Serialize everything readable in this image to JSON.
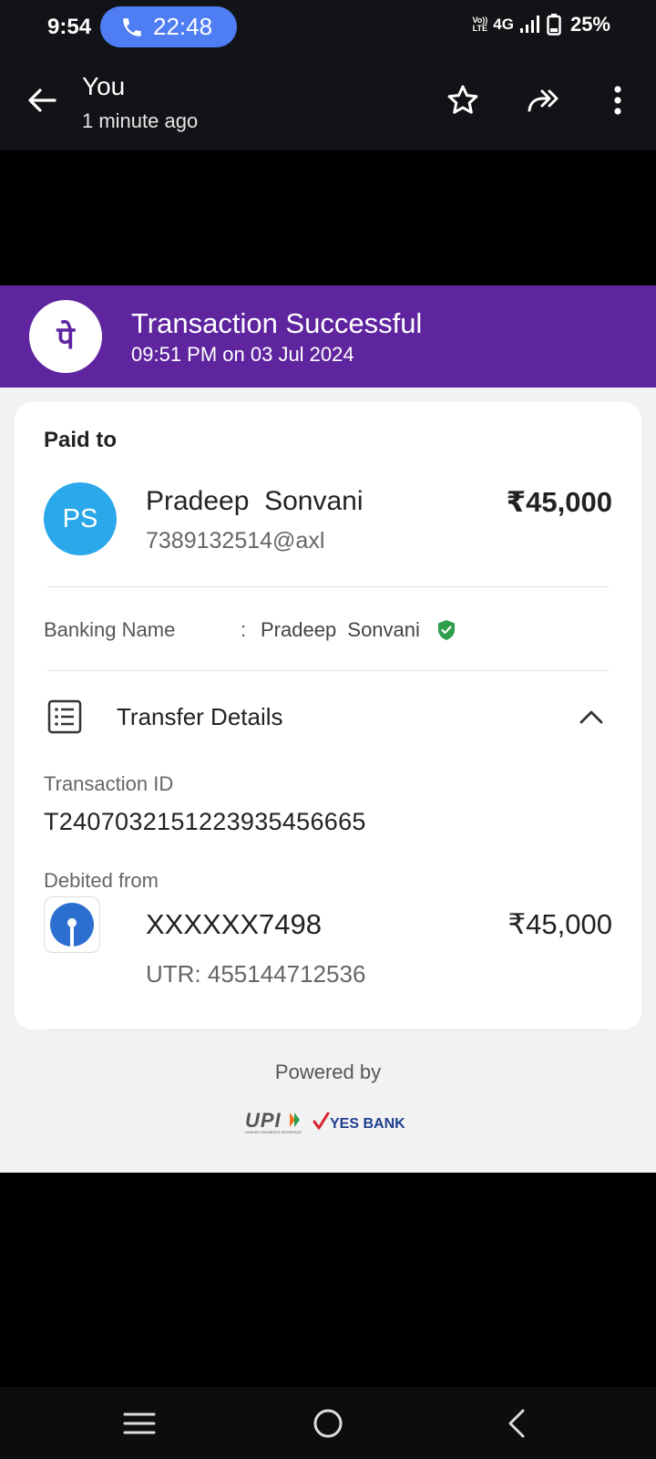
{
  "status_bar": {
    "time": "9:54",
    "call_duration": "22:48",
    "volte_top": "Vo))",
    "volte_bottom": "LTE",
    "network": "4G",
    "battery": "25%"
  },
  "header": {
    "sender": "You",
    "sent_time": "1 minute ago",
    "icons": [
      "back-arrow-icon",
      "star-icon",
      "forward-icon",
      "more-vert-icon"
    ]
  },
  "receipt": {
    "banner": {
      "title": "Transaction Successful",
      "datetime": "09:51 PM on 03 Jul 2024",
      "brand_color": "#5f259f",
      "logo_glyph": "पे"
    },
    "paid_to_label": "Paid to",
    "payee": {
      "initials": "PS",
      "name": "Pradeep  Sonvani",
      "upi_id": "7389132514@axl",
      "amount": "₹45,000"
    },
    "banking": {
      "label": "Banking Name",
      "colon": ":",
      "name": "Pradeep  Sonvani"
    },
    "transfer_details_label": "Transfer Details",
    "transaction_id_label": "Transaction ID",
    "transaction_id": "T2407032151223935456665",
    "debited_from_label": "Debited from",
    "debit": {
      "account": "XXXXXX7498",
      "amount": "₹45,000",
      "utr": "UTR: 455144712536"
    },
    "powered_by": "Powered by",
    "partner_logos": {
      "upi_text": "UPI",
      "upi_tagline": "UNIFIED PAYMENTS INTERFACE",
      "bank_text": "YES BANK"
    }
  },
  "nav_bar": {
    "icons": [
      "menu-icon",
      "home-icon",
      "back-icon"
    ]
  }
}
